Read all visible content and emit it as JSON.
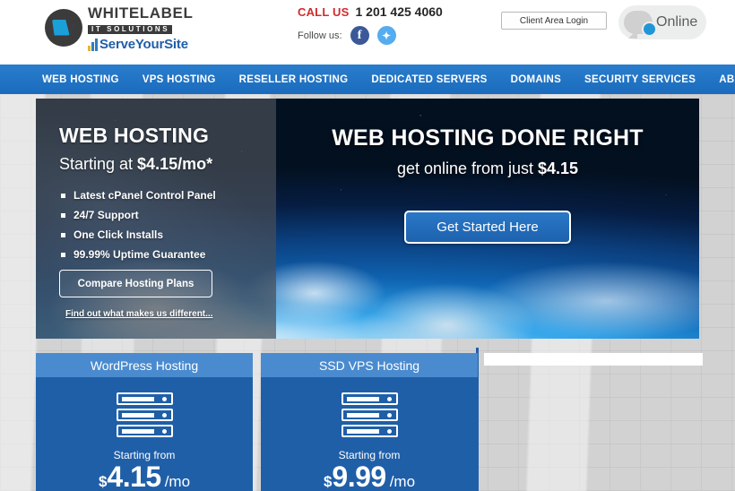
{
  "header": {
    "logo": {
      "line1": "WHITELABEL",
      "line2": "IT SOLUTIONS",
      "line3": "ServeYourSite",
      "mark_icon": "whitelabel-swoosh-logo-icon"
    },
    "call_us_label": "CALL US",
    "phone": "1 201 425 4060",
    "follow_label": "Follow us:",
    "social": [
      {
        "name": "facebook-icon",
        "glyph": "f"
      },
      {
        "name": "twitter-icon",
        "glyph": "✦"
      }
    ],
    "client_login_label": "Client Area Login",
    "chat": {
      "label": "Online",
      "icon": "chat-bubble-icon",
      "status_color": "#2196d6"
    }
  },
  "nav": {
    "items": [
      {
        "label": "WEB HOSTING"
      },
      {
        "label": "VPS HOSTING"
      },
      {
        "label": "RESELLER HOSTING"
      },
      {
        "label": "DEDICATED SERVERS"
      },
      {
        "label": "DOMAINS"
      },
      {
        "label": "SECURITY SERVICES"
      },
      {
        "label": "ABOUT US"
      }
    ],
    "background_color": "#1f72c4"
  },
  "hero": {
    "panel": {
      "title": "WEB HOSTING",
      "subtitle_prefix": "Starting at ",
      "subtitle_price": "$4.15/mo*",
      "features": [
        "Latest cPanel Control Panel",
        "24/7 Support",
        "One Click Installs",
        "99.99% Uptime Guarantee"
      ],
      "button_label": "Compare Hosting Plans",
      "link_label": "Find out what makes us different..."
    },
    "banner": {
      "title": "WEB HOSTING DONE RIGHT",
      "subtitle_prefix": "get online from just ",
      "subtitle_price": "$4.15",
      "cta_label": "Get Started Here"
    }
  },
  "cards": [
    {
      "title": "WordPress Hosting",
      "icon": "server-stack-icon",
      "from_label": "Starting from",
      "currency": "$",
      "amount": "4.15",
      "period": "/mo"
    },
    {
      "title": "SSD VPS Hosting",
      "icon": "server-stack-icon",
      "from_label": "Starting from",
      "currency": "$",
      "amount": "9.99",
      "period": "/mo"
    }
  ]
}
